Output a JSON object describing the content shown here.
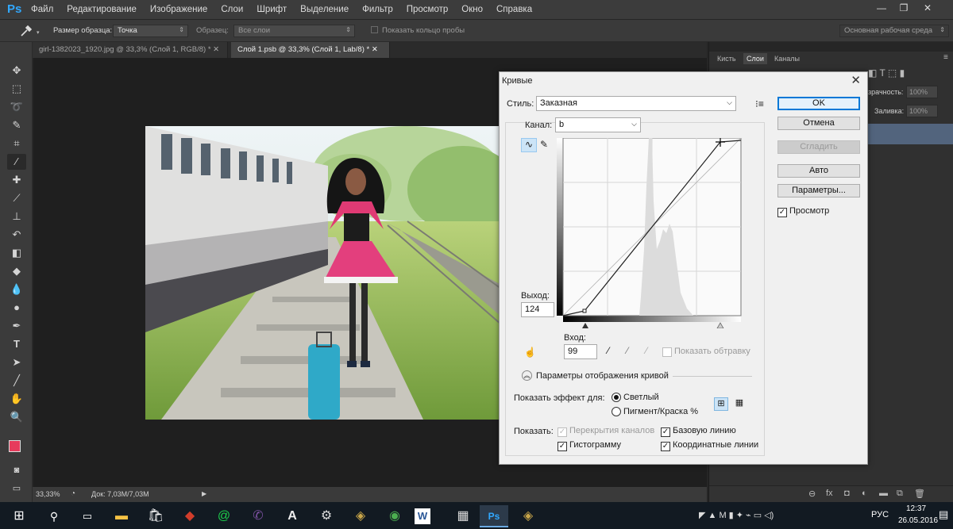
{
  "app": {
    "logo": "Ps",
    "menu": [
      "Файл",
      "Редактирование",
      "Изображение",
      "Слои",
      "Шрифт",
      "Выделение",
      "Фильтр",
      "Просмотр",
      "Окно",
      "Справка"
    ],
    "window_controls": [
      "—",
      "❐",
      "✕"
    ]
  },
  "options_bar": {
    "sample_size_label": "Размер образца:",
    "sample_size_value": "Точка",
    "sample_label": "Образец:",
    "sample_value": "Все слои",
    "show_ring_label": "Показать кольцо пробы",
    "workspace": "Основная рабочая среда"
  },
  "tabs": [
    {
      "label": "girl-1382023_1920.jpg @ 33,3% (Слой 1, RGB/8) *"
    },
    {
      "label": "Слой 1.psb @ 33,3% (Слой 1, Lab/8) *"
    }
  ],
  "status": {
    "zoom": "33,33%",
    "doc": "Док: 7,03M/7,03M"
  },
  "panels": {
    "tabs": [
      "Кисть",
      "Слои",
      "Каналы"
    ],
    "opacity_label": "зрачность:",
    "opacity_value": "100%",
    "fill_label": "Заливка:",
    "fill_value": "100%"
  },
  "dialog": {
    "title": "Кривые",
    "style_label": "Стиль:",
    "style_value": "Заказная",
    "channel_label": "Канал:",
    "channel_value": "b",
    "output_label": "Выход:",
    "output_value": "124",
    "input_label": "Вход:",
    "input_value": "99",
    "show_clipping_label": "Показать обтравку",
    "buttons": {
      "ok": "OK",
      "cancel": "Отмена",
      "smooth": "Сгладить",
      "auto": "Авто",
      "options": "Параметры..."
    },
    "preview_label": "Просмотр",
    "curve_options_label": "Параметры отображения кривой",
    "show_effect_label": "Показать эффект для:",
    "radio_light": "Светлый",
    "radio_pigment": "Пигмент/Краска %",
    "show_label": "Показать:",
    "chk_overlay": "Перекрытия каналов",
    "chk_histogram": "Гистограмму",
    "chk_baseline": "Базовую линию",
    "chk_grid": "Координатные линии"
  },
  "taskbar": {
    "lang": "РУС",
    "time": "12:37",
    "date": "26.05.2016",
    "word_letter": "W",
    "ps_letter": "Ps",
    "a_letter": "A"
  }
}
